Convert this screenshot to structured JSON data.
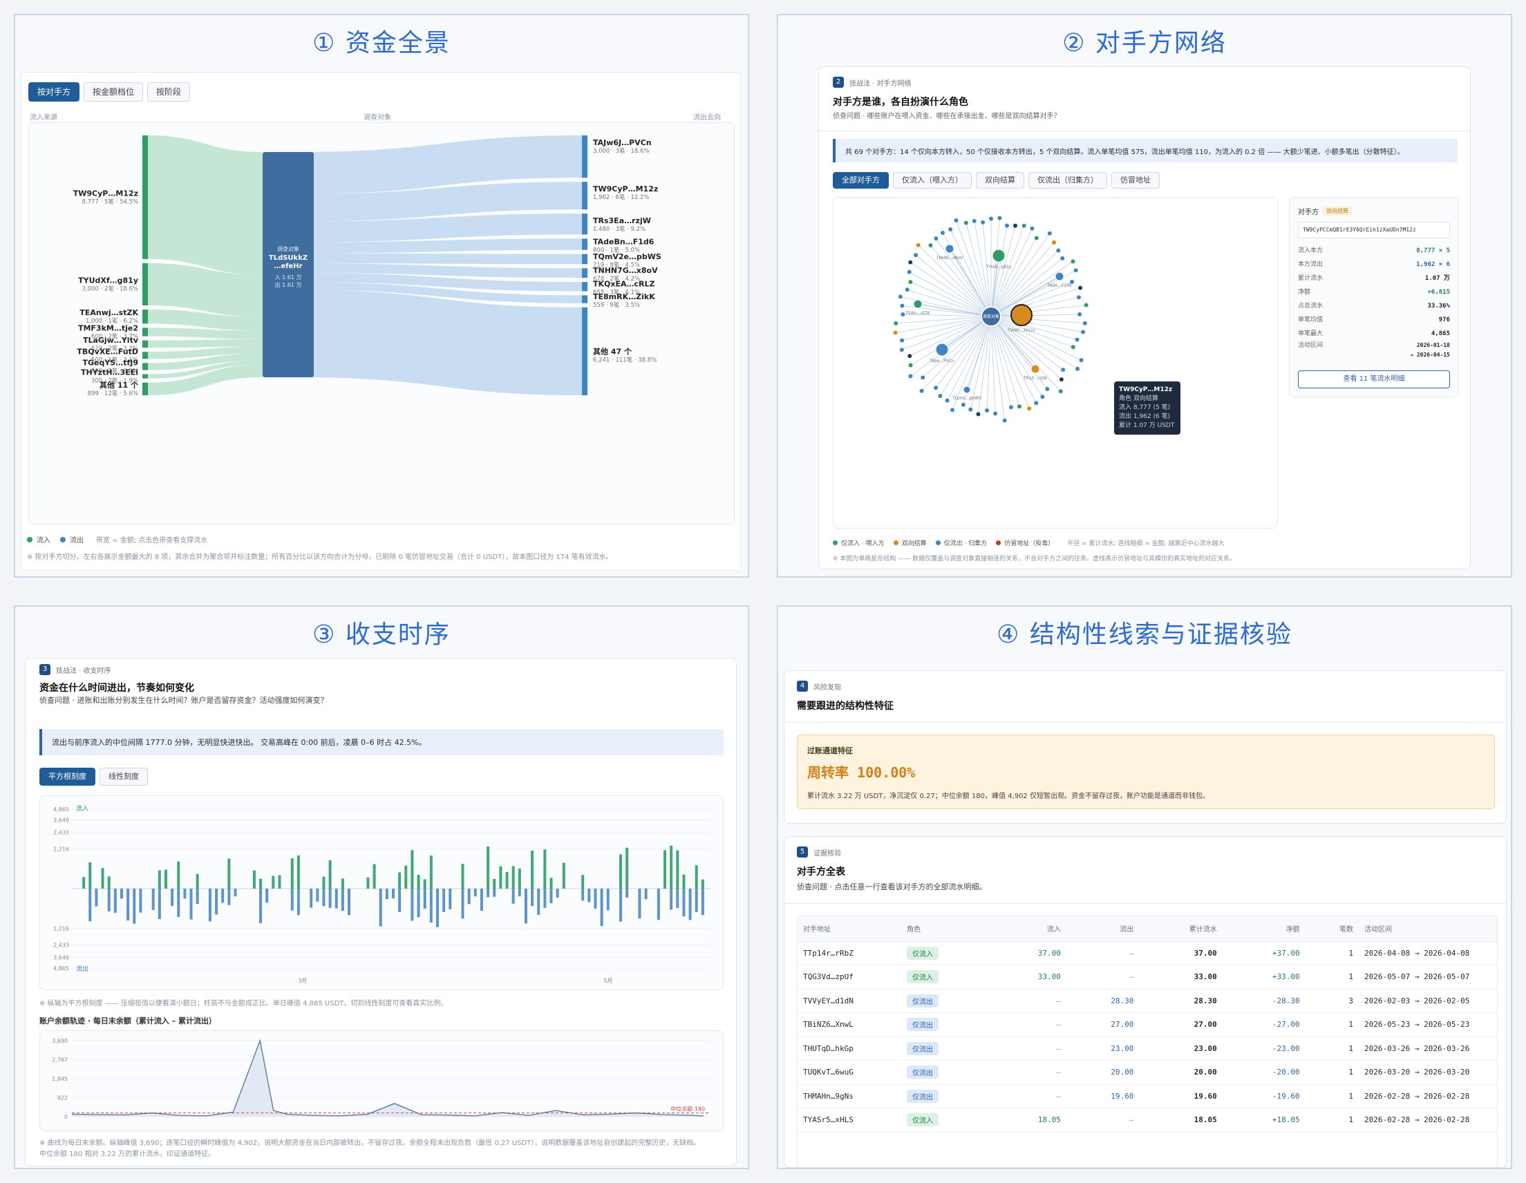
{
  "quad1": {
    "title": "① 资金全景",
    "tabs": [
      "按对手方",
      "按金额档位",
      "按阶段"
    ],
    "col_left": "流入来源",
    "col_mid": "调查对象",
    "col_right": "流出去向",
    "inflows": [
      {
        "name": "TW9CyP…M12z",
        "meta": "8,777 · 5笔 · 54.5%"
      },
      {
        "name": "TYUdXf…g81y",
        "meta": "3,000 · 2笔 · 18.6%"
      },
      {
        "name": "TEAnwj…stZK",
        "meta": "1,000 · 1笔 · 6.2%"
      },
      {
        "name": "TMF3kM…tje2",
        "meta": "600 · 2笔 · 3.7%"
      },
      {
        "name": "TLaGjw…Yitv",
        "meta": "519 · 2笔 · 3.2%"
      },
      {
        "name": "TBQvXE…FutD",
        "meta": "500 · 1笔 · 3.1%"
      },
      {
        "name": "TGeqYS…tfJ9",
        "meta": "500 · 1笔 · 3.1%"
      },
      {
        "name": "THYztH…3EEi",
        "meta": "300 · 2笔 · 1.9%"
      },
      {
        "name": "其他 11 个",
        "meta": "899 · 12笔 · 5.6%"
      }
    ],
    "outflows": [
      {
        "name": "TAJw6J…PVCn",
        "meta": "3,000 · 3笔 · 18.6%"
      },
      {
        "name": "TW9CyP…M12z",
        "meta": "1,962 · 6笔 · 12.2%"
      },
      {
        "name": "TRs3Ea…rzjW",
        "meta": "1,480 · 3笔 · 9.2%"
      },
      {
        "name": "TAdeBn…F1d6",
        "meta": "800 · 1笔 · 5.0%"
      },
      {
        "name": "TQmV2e…pbWS",
        "meta": "719 · 8笔 · 4.5%"
      },
      {
        "name": "TNHN7G…x8oV",
        "meta": "678 · 2笔 · 4.2%"
      },
      {
        "name": "TKQxEA…cRLZ",
        "meta": "655 · 3笔 · 4.1%"
      },
      {
        "name": "TE8mRK…ZikK",
        "meta": "559 · 9笔 · 3.5%"
      },
      {
        "name": "其他 47 个",
        "meta": "6,241 · 111笔 · 38.8%"
      }
    ],
    "center": {
      "label": "调查对象",
      "addr1": "TLdSUkkZ",
      "addr2": "…efeHr",
      "in": "入 1.61 万",
      "out": "出 1.61 万"
    },
    "legend_in": "流入",
    "legend_out": "流出",
    "legend_note": "带宽 = 金额; 点击色带查看支撑流水",
    "footnote": "※ 按对手方切分。左右各展示金额最大的 8 项，其余合并为聚合项并标注数量；所有百分比以该方向合计为分母。已剔除 0 笔仿冒地址交易（合计 0 USDT），故本图口径为 174 笔有效流水。",
    "colors": {
      "in": "#2e9e63",
      "out": "#3d85c6",
      "center": "#3f6d9f"
    }
  },
  "quad2": {
    "title": "② 对手方网络",
    "sec_num": "2",
    "sec_label": "技战法 · 对手方网络",
    "heading": "对手方是谁，各自扮演什么角色",
    "question": "侦查问题 · 哪些账户在喂入资金、哪些在承接出金、哪些是双向结算对手？",
    "callout": "共 69 个对手方：14 个仅向本方转入，50 个仅接收本方转出，5 个双向结算。流入单笔均值 575，流出单笔均值 110，为流入的 0.2 倍 —— 大额少笔进、小额多笔出（分散特征）。",
    "tabs": [
      "全部对手方",
      "仅流入（喂入方）",
      "双向结算",
      "仅流出（归集方）",
      "仿冒地址"
    ],
    "center_label": "调查对象",
    "node_labels": [
      "TNHN…x8oV",
      "TYUd…g81y",
      "TAde…F1d6",
      "TEAn…stZK",
      "TW9C…M12z",
      "TAJw…PVCn",
      "TRs3…rzjW",
      "TQmV…pbWS"
    ],
    "tooltip": {
      "title": "TW9CyP…M12z",
      "l1": "角色 双向结算",
      "l2": "流入 8,777 (5 笔)",
      "l3": "流出 1,962 (6 笔)",
      "l4": "累计 1.07 万 USDT"
    },
    "detail": {
      "title": "对手方",
      "badge": "双向结算",
      "address": "TW9CyPCCmQB1rE3Y6QrEih1zXaUDn7M12z",
      "rows": [
        {
          "k": "流入本方",
          "v": "8,777 × 5"
        },
        {
          "k": "本方流出",
          "v": "1,962 × 6"
        },
        {
          "k": "累计流水",
          "v": "1.07 万"
        },
        {
          "k": "净额",
          "v": "+6,815"
        },
        {
          "k": "占总流水",
          "v": "33.36%"
        },
        {
          "k": "单笔均值",
          "v": "976"
        },
        {
          "k": "单笔最大",
          "v": "4,865"
        },
        {
          "k": "活动区间",
          "v": "2026-01-18"
        },
        {
          "k": "",
          "v": "→ 2026-04-15"
        }
      ],
      "button": "查看 11 笔流水明细"
    },
    "legend": [
      "仅流入 · 喂入方",
      "双向结算",
      "仅流出 · 归集方",
      "仿冒地址（投毒）"
    ],
    "legend_note": "半径 = 累计流水; 连线粗细 = 金额; 越靠近中心流水越大",
    "footnote": "※ 本图为单跳星形结构 —— 数据仅覆盖与调查对象直接相连的关系，不含对手方之间的往来。虚线表示仿冒地址与其模仿的真实地址的对应关系。",
    "colors": {
      "in": "#2e9e63",
      "both": "#d88a1f",
      "out": "#3d85c6",
      "fake": "#c0392b"
    }
  },
  "quad3": {
    "title": "③ 收支时序",
    "sec_num": "3",
    "sec_label": "技战法 · 收支时序",
    "heading": "资金在什么时间进出，节奏如何变化",
    "question": "侦查问题 · 进账和出账分别发生在什么时间？账户是否留存资金？活动强度如何演变？",
    "callout": "流出与前序流入的中位间隔 1777.0 分钟，无明显快进快出。 交易高峰在 0:00 前后，凌晨 0–6 时占 42.5%。",
    "tabs": [
      "平方根刻度",
      "线性刻度"
    ],
    "bar_axis": {
      "in_label": "流入",
      "out_label": "流出",
      "ticks": [
        "4,865",
        "3,649",
        "2,433",
        "1,216"
      ],
      "months": [
        "3月",
        "5月"
      ]
    },
    "bar_footnote": "※ 纵轴为平方根刻度 —— 压缩极值以便看清小额日；柱高不与金额成正比。单日峰值 4,865 USDT。切到线性刻度可查看真实比例。",
    "balance_title": "账户余额轨迹 · 每日末余额（累计流入 – 累计流出）",
    "balance_ticks": [
      "3,690",
      "2,767",
      "1,845",
      "922",
      "0"
    ],
    "median_label": "中位余额 180",
    "balance_footnote_1": "※ 曲线为每日末余额。纵轴峰值 3,690；逐笔口径的瞬时峰值为 4,902，说明大额资金在当日内部被转出，不留存过夜。余额全程未出现负数（最低 0.27 USDT），说明数据覆盖该地址自创建起的完整历史，无缺档。",
    "balance_footnote_2": "中位余额 180 相对 3.22 万的累计流水，印证通道特征。",
    "colors": {
      "in": "#3fa874",
      "out": "#5b93d1"
    }
  },
  "quad4": {
    "title": "④ 结构性线索与证据核验",
    "risk": {
      "sec_num": "4",
      "sec_label": "风险发现",
      "heading": "需要跟进的结构性特征",
      "box_title": "过账通道特征",
      "metric": "周转率 100.00%",
      "desc": "累计流水 3.22 万 USDT，净沉淀仅 0.27；中位余额 180，峰值 4,902 仅短暂出现。资金不留存过夜，账户功能是通道而非钱包。"
    },
    "table": {
      "sec_num": "5",
      "sec_label": "证据核验",
      "heading": "对手方全表",
      "question": "侦查问题 · 点击任意一行查看该对手方的全部流水明细。",
      "headers": [
        "对手地址",
        "角色",
        "流入",
        "流出",
        "累计流水",
        "净额",
        "笔数",
        "活动区间"
      ],
      "rows": [
        {
          "addr": "TTp14r…rRbZ",
          "role": "仅流入",
          "type": "in",
          "inflow": "37.00",
          "outflow": "–",
          "total": "37.00",
          "net": "+37.00",
          "n": "1",
          "range": "2026-04-08 → 2026-04-08"
        },
        {
          "addr": "TQG3Vd…zpUf",
          "role": "仅流入",
          "type": "in",
          "inflow": "33.00",
          "outflow": "–",
          "total": "33.00",
          "net": "+33.00",
          "n": "1",
          "range": "2026-05-07 → 2026-05-07"
        },
        {
          "addr": "TVVyEY…d1dN",
          "role": "仅流出",
          "type": "out",
          "inflow": "–",
          "outflow": "28.30",
          "total": "28.30",
          "net": "-28.30",
          "n": "3",
          "range": "2026-02-03 → 2026-02-05"
        },
        {
          "addr": "TBiNZ6…XnwL",
          "role": "仅流出",
          "type": "out",
          "inflow": "–",
          "outflow": "27.00",
          "total": "27.00",
          "net": "-27.00",
          "n": "1",
          "range": "2026-05-23 → 2026-05-23"
        },
        {
          "addr": "THUTqD…hkGp",
          "role": "仅流出",
          "type": "out",
          "inflow": "–",
          "outflow": "23.00",
          "total": "23.00",
          "net": "-23.00",
          "n": "1",
          "range": "2026-03-26 → 2026-03-26"
        },
        {
          "addr": "TUQKvT…6wuG",
          "role": "仅流出",
          "type": "out",
          "inflow": "–",
          "outflow": "20.00",
          "total": "20.00",
          "net": "-20.00",
          "n": "1",
          "range": "2026-03-20 → 2026-03-20"
        },
        {
          "addr": "THMAHn…9gNs",
          "role": "仅流出",
          "type": "out",
          "inflow": "–",
          "outflow": "19.60",
          "total": "19.60",
          "net": "-19.60",
          "n": "1",
          "range": "2026-02-28 → 2026-02-28"
        },
        {
          "addr": "TYASr5…xHLS",
          "role": "仅流入",
          "type": "in",
          "inflow": "18.05",
          "outflow": "–",
          "total": "18.05",
          "net": "+18.05",
          "n": "1",
          "range": "2026-02-28 → 2026-02-28"
        }
      ]
    }
  }
}
